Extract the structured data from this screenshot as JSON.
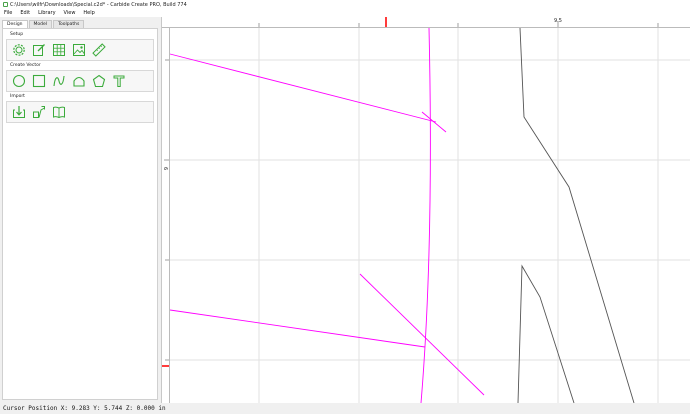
{
  "window": {
    "title": "C:\\Users\\wilfr\\Downloads\\Special.c2d* - Carbide Create PRO, Build 774"
  },
  "menu": {
    "items": [
      "File",
      "Edit",
      "Library",
      "View",
      "Help"
    ]
  },
  "tabs": [
    "Design",
    "Model",
    "Toolpaths"
  ],
  "sections": {
    "setup": "Setup",
    "create_vector": "Create Vector",
    "import": "Import"
  },
  "icons": {
    "setup": [
      "gear-icon",
      "edit-icon",
      "grid-icon",
      "image-icon",
      "ruler-icon"
    ],
    "create_vector": [
      "circle-icon",
      "rectangle-icon",
      "curve-icon",
      "polygon-rounded-icon",
      "pentagon-icon",
      "text-icon"
    ],
    "import": [
      "import-icon",
      "import-geometry-icon",
      "book-icon"
    ]
  },
  "rulers": {
    "x_label": "9.5",
    "y_label": "6"
  },
  "colors": {
    "accent": "#3cab3c",
    "toolpath": "#ff00ff",
    "geometry": "#555555",
    "marker": "#ff3b3b"
  },
  "status": {
    "text": "Cursor Position X: 9.283 Y: 5.744 Z: 0.000 in"
  }
}
